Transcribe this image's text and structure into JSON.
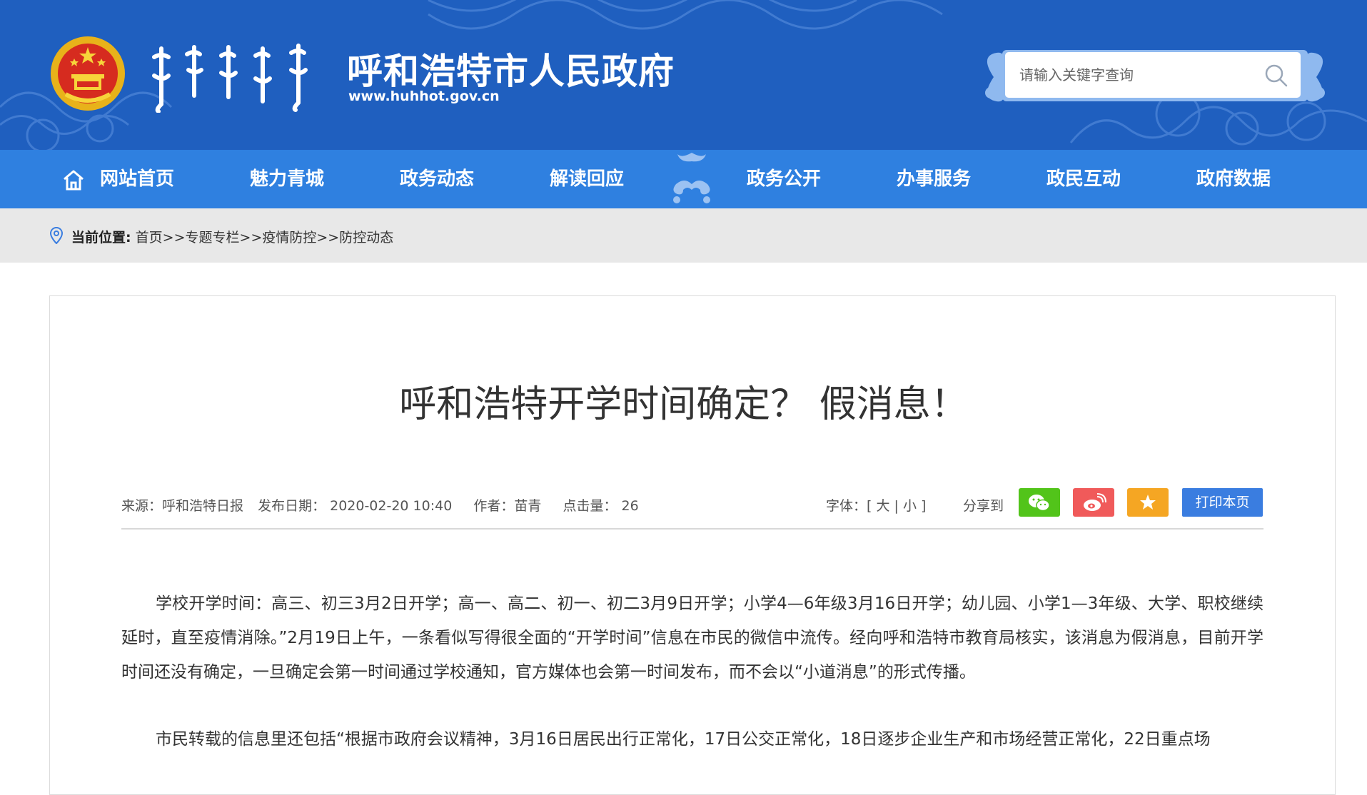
{
  "header": {
    "site_title": "呼和浩特市人民政府",
    "site_url": "www.huhhot.gov.cn",
    "search_placeholder": "请输入关键字查询"
  },
  "nav": {
    "items": [
      {
        "label": "网站首页"
      },
      {
        "label": "魅力青城"
      },
      {
        "label": "政务动态"
      },
      {
        "label": "解读回应"
      },
      {
        "label": "政务公开"
      },
      {
        "label": "办事服务"
      },
      {
        "label": "政民互动"
      },
      {
        "label": "政府数据"
      }
    ]
  },
  "breadcrumb": {
    "label": "当前位置:",
    "items": [
      "首页",
      "专题专栏",
      "疫情防控",
      "防控动态"
    ],
    "separator": ">>"
  },
  "article": {
    "title": "呼和浩特开学时间确定？ 假消息！",
    "source": "来源：呼和浩特日报",
    "date": "发布日期：  2020-02-20 10:40",
    "author": "作者：苗青",
    "clicks": "点击量：  26",
    "font_label": "字体：[",
    "font_large": "大",
    "font_sep": "|",
    "font_small": "小",
    "font_end": "]",
    "share_label": "分享到",
    "print_label": "打印本页",
    "paragraphs": [
      "学校开学时间：高三、初三3月2日开学；高一、高二、初一、初二3月9日开学；小学4—6年级3月16日开学；幼儿园、小学1—3年级、大学、职校继续延时，直至疫情消除。”2月19日上午，一条看似写得很全面的“开学时间”信息在市民的微信中流传。经向呼和浩特市教育局核实，该消息为假消息，目前开学时间还没有确定，一旦确定会第一时间通过学校通知，官方媒体也会第一时间发布，而不会以“小道消息”的形式传播。",
      "市民转载的信息里还包括“根据市政府会议精神，3月16日居民出行正常化，17日公交正常化，18日逐步企业生产和市场经营正常化，22日重点场"
    ]
  },
  "colors": {
    "banner": "#1f5fbf",
    "nav": "#2f80e0",
    "wechat": "#52c41a",
    "weibo": "#f05a5a",
    "favorite": "#f5a623",
    "print": "#3a7de0"
  }
}
